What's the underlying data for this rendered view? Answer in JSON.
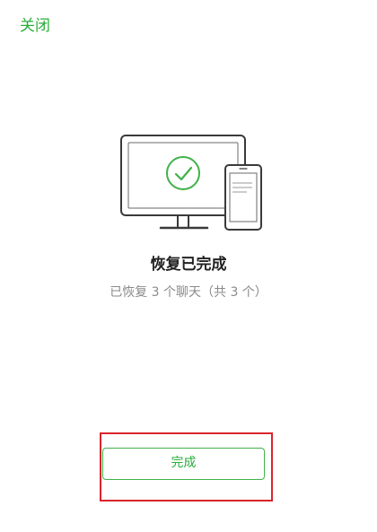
{
  "header": {
    "close_label": "关闭"
  },
  "main": {
    "title": "恢复已完成",
    "subtitle": "已恢复 3 个聊天（共 3 个）",
    "done_button_label": "完成"
  },
  "colors": {
    "accent": "#2aae3a",
    "highlight": "#d9242b"
  },
  "icons": {
    "illustration": "monitor-phone-icon",
    "status": "check-circle-icon"
  }
}
